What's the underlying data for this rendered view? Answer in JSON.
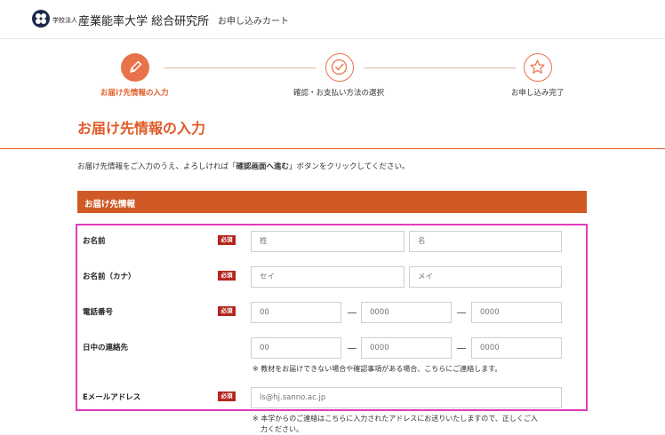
{
  "header": {
    "school_prefix": "学校法人",
    "school_name": "産業能率大学 総合研究所",
    "cart_title": "お申し込みカート"
  },
  "steps": [
    {
      "label": "お届け先情報の入力",
      "icon": "pencil-icon",
      "state": "active"
    },
    {
      "label": "確認・お支払い方法の選択",
      "icon": "check-icon",
      "state": "inactive"
    },
    {
      "label": "お申し込み完了",
      "icon": "star-icon",
      "state": "inactive"
    }
  ],
  "page_title": "お届け先情報の入力",
  "intro": {
    "before": "お届け先情報をご入力のうえ、よろしければ「",
    "emphasis": "確認画面へ進む",
    "after": "」ボタンをクリックしてください。"
  },
  "section_title": "お届け先情報",
  "required_badge": "必須",
  "fields": {
    "name": {
      "label": "お名前",
      "placeholder_last": "姓",
      "placeholder_first": "名"
    },
    "kana": {
      "label": "お名前（カナ）",
      "placeholder_last": "セイ",
      "placeholder_first": "メイ"
    },
    "phone": {
      "label": "電話番号",
      "part1": "00",
      "part2": "0000",
      "part3": "0000"
    },
    "daytime": {
      "label": "日中の連絡先",
      "part1": "00",
      "part2": "0000",
      "part3": "0000",
      "note": "※ 教材をお届けできない場合や確認事項がある場合、こちらにご連絡します。"
    },
    "email": {
      "label": "Eメールアドレス",
      "placeholder": "ls@hj.sanno.ac.jp",
      "note_line1": "※ 本学からのご連絡はこちらに入力されたアドレスにお送りいたしますので、正しくご入",
      "note_line2": "力ください。"
    }
  },
  "colors": {
    "accent": "#e05a28",
    "section": "#cf5a26",
    "required": "#b3271c",
    "highlight": "#e23cbc"
  }
}
